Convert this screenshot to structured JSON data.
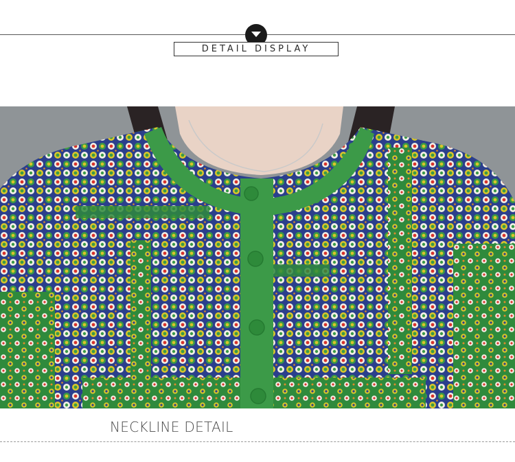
{
  "header": {
    "title": "DETAIL DISPLAY",
    "badge_icon": "chevron-down-icon"
  },
  "photo": {
    "subject": "garment-neckline-photo",
    "colors": {
      "fabric_green": "#2f8a3c",
      "trim_green": "#3c9a48",
      "pattern_blue": "#2b3f8c",
      "dot_white": "#f2efe6",
      "dot_red": "#d8332b",
      "dot_yellow": "#d9c52a",
      "skin": "#e9d3c6",
      "hair": "#2a2324",
      "background": "#8f9497"
    }
  },
  "caption": {
    "text": "NECKLINE DETAIL"
  }
}
